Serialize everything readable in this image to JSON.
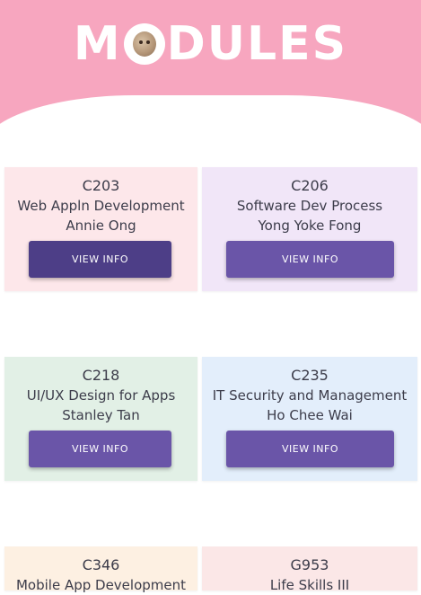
{
  "header": {
    "title_part1": "M",
    "title_part2": "DULES",
    "avatar_icon": "avatar-icon",
    "color": "#f7a6bf"
  },
  "modules": [
    {
      "code": "C203",
      "name": "Web Appln Development",
      "lecturer": "Annie Ong",
      "button_label": "VIEW INFO",
      "bg": "#fde7ea",
      "button_color": "#4d3e87"
    },
    {
      "code": "C206",
      "name": "Software Dev Process",
      "lecturer": "Yong Yoke Fong",
      "button_label": "VIEW INFO",
      "bg": "#f1e6f8",
      "button_color": "#6a55a8"
    },
    {
      "code": "C218",
      "name": "UI/UX Design for Apps",
      "lecturer": "Stanley Tan",
      "button_label": "VIEW INFO",
      "bg": "#e2f0e6",
      "button_color": "#6a55a8"
    },
    {
      "code": "C235",
      "name": "IT Security and Management",
      "lecturer": "Ho Chee Wai",
      "button_label": "VIEW INFO",
      "bg": "#e3eefb",
      "button_color": "#6a55a8"
    },
    {
      "code": "C346",
      "name": "Mobile App Development",
      "bg": "#fdf0e2"
    },
    {
      "code": "G953",
      "name": "Life Skills III",
      "bg": "#fbe7e7"
    }
  ]
}
